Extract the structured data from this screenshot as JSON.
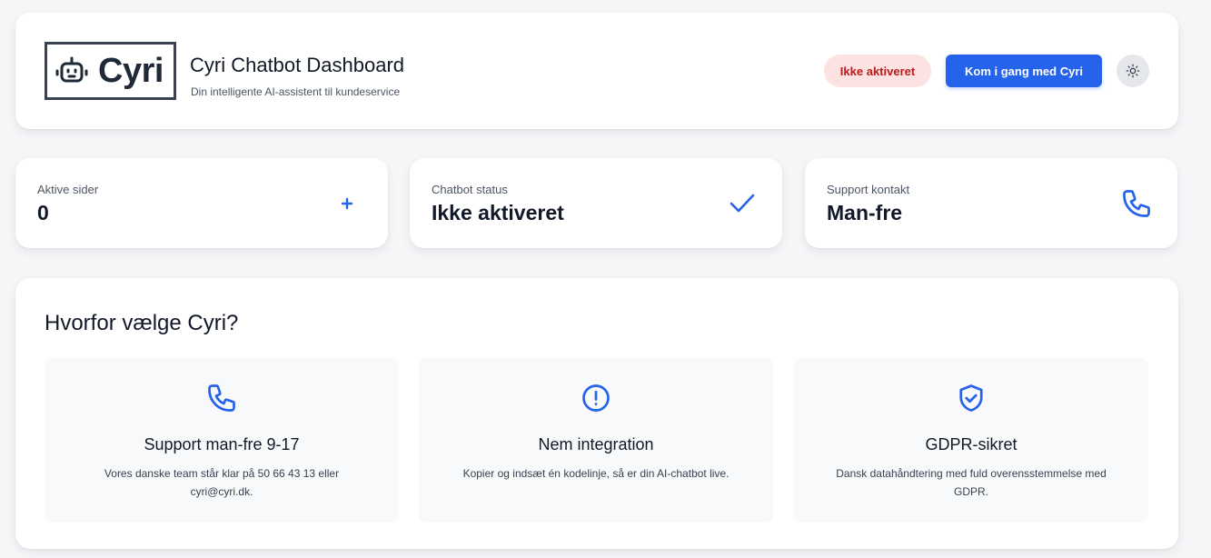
{
  "header": {
    "logo_text": "Cyri",
    "logo_icon": "robot-icon",
    "title": "Cyri Chatbot Dashboard",
    "subtitle": "Din intelligente AI-assistent til kundeservice",
    "status_label": "Ikke aktiveret",
    "cta_label": "Kom i gang med Cyri",
    "theme_icon": "sun-icon"
  },
  "stats": [
    {
      "label": "Aktive sider",
      "value": "0",
      "icon": "plus-icon"
    },
    {
      "label": "Chatbot status",
      "value": "Ikke aktiveret",
      "icon": "check-icon"
    },
    {
      "label": "Support kontakt",
      "value": "Man-fre",
      "icon": "phone-icon"
    }
  ],
  "features": {
    "title": "Hvorfor vælge Cyri?",
    "items": [
      {
        "icon": "phone-icon",
        "title": "Support man-fre 9-17",
        "description": "Vores danske team står klar på 50 66 43 13 eller cyri@cyri.dk."
      },
      {
        "icon": "exclamation-circle-icon",
        "title": "Nem integration",
        "description": "Kopier og indsæt én kodelinje, så er din AI-chatbot live."
      },
      {
        "icon": "shield-check-icon",
        "title": "GDPR-sikret",
        "description": "Dansk datahåndtering med fuld overensstemmelse med GDPR."
      }
    ]
  },
  "colors": {
    "accent": "#2563eb",
    "status_bg": "#fde2e2",
    "status_text": "#b91c1c",
    "page_bg": "#f5f6f8"
  }
}
